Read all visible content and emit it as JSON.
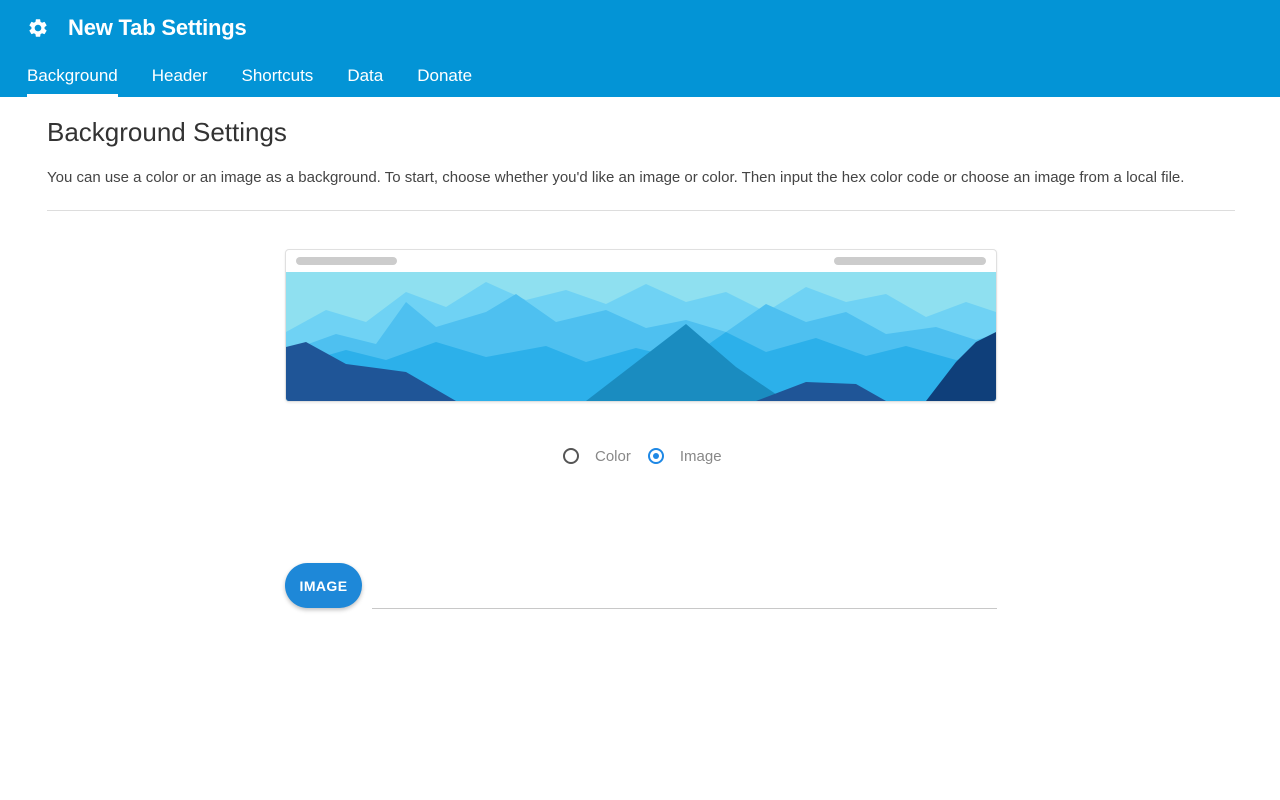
{
  "header": {
    "title": "New Tab Settings",
    "icon": "gear-icon",
    "background_color": "#0394d6"
  },
  "tabs": [
    {
      "label": "Background",
      "active": true
    },
    {
      "label": "Header",
      "active": false
    },
    {
      "label": "Shortcuts",
      "active": false
    },
    {
      "label": "Data",
      "active": false
    },
    {
      "label": "Donate",
      "active": false
    }
  ],
  "main": {
    "title": "Background Settings",
    "description": "You can use a color or an image as a background. To start, choose whether you'd like an image or color. Then input the hex color code or choose an image from a local file."
  },
  "background_type": {
    "options": [
      {
        "label": "Color",
        "checked": false
      },
      {
        "label": "Image",
        "checked": true
      }
    ],
    "accent_color": "#1e88e5"
  },
  "image_picker": {
    "button_label": "IMAGE",
    "file_value": ""
  }
}
